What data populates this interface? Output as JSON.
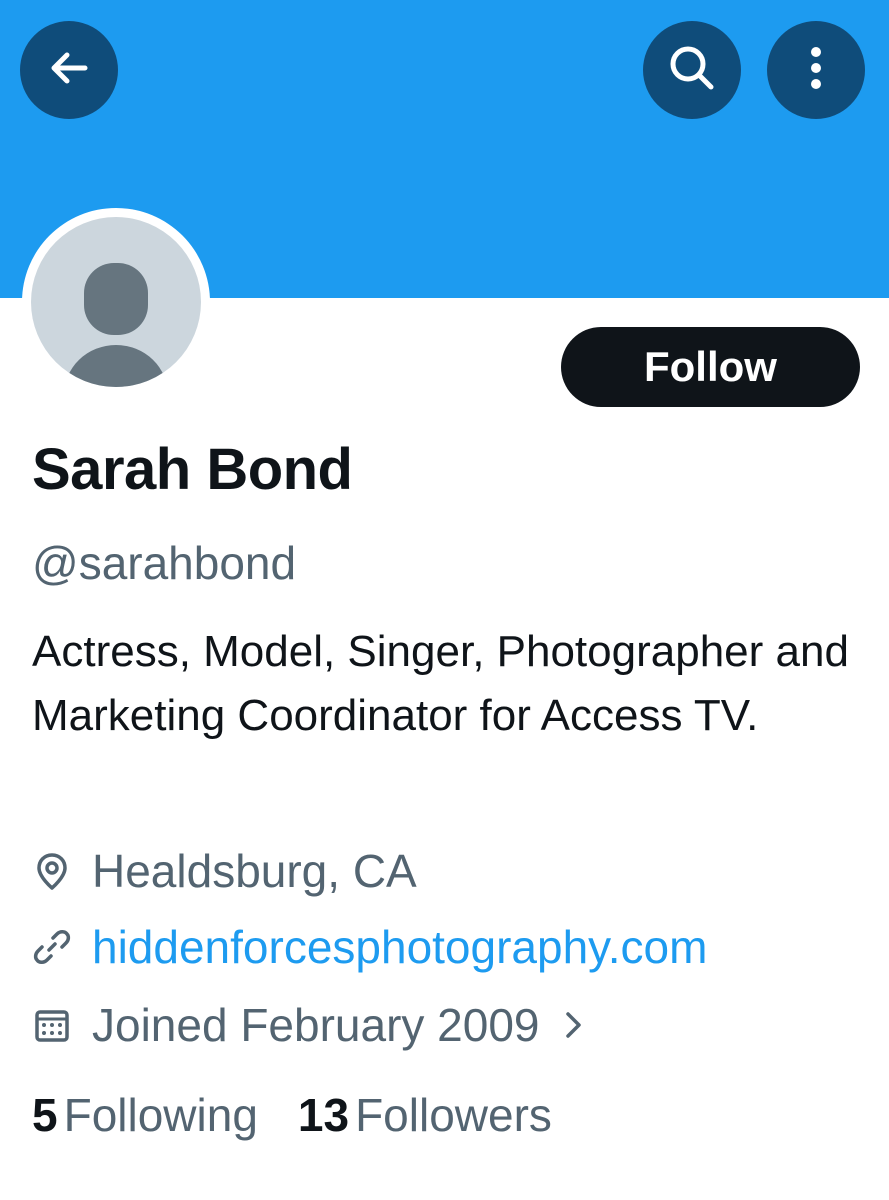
{
  "header": {
    "back_icon": "arrow-left-icon",
    "search_icon": "search-icon",
    "more_icon": "more-vertical-icon",
    "banner_color": "#1d9bf0",
    "button_color": "#0f4c7a"
  },
  "profile": {
    "name": "Sarah Bond",
    "handle": "@sarahbond",
    "bio": "Actress, Model, Singer, Photographer and Marketing Coordinator for Access TV.",
    "follow_label": "Follow",
    "location": "Healdsburg, CA",
    "website": "hiddenforcesphotography.com",
    "joined": "Joined February 2009",
    "link_color": "#1d9bf0"
  },
  "stats": {
    "following_count": "5",
    "following_label": "Following",
    "followers_count": "13",
    "followers_label": "Followers"
  }
}
